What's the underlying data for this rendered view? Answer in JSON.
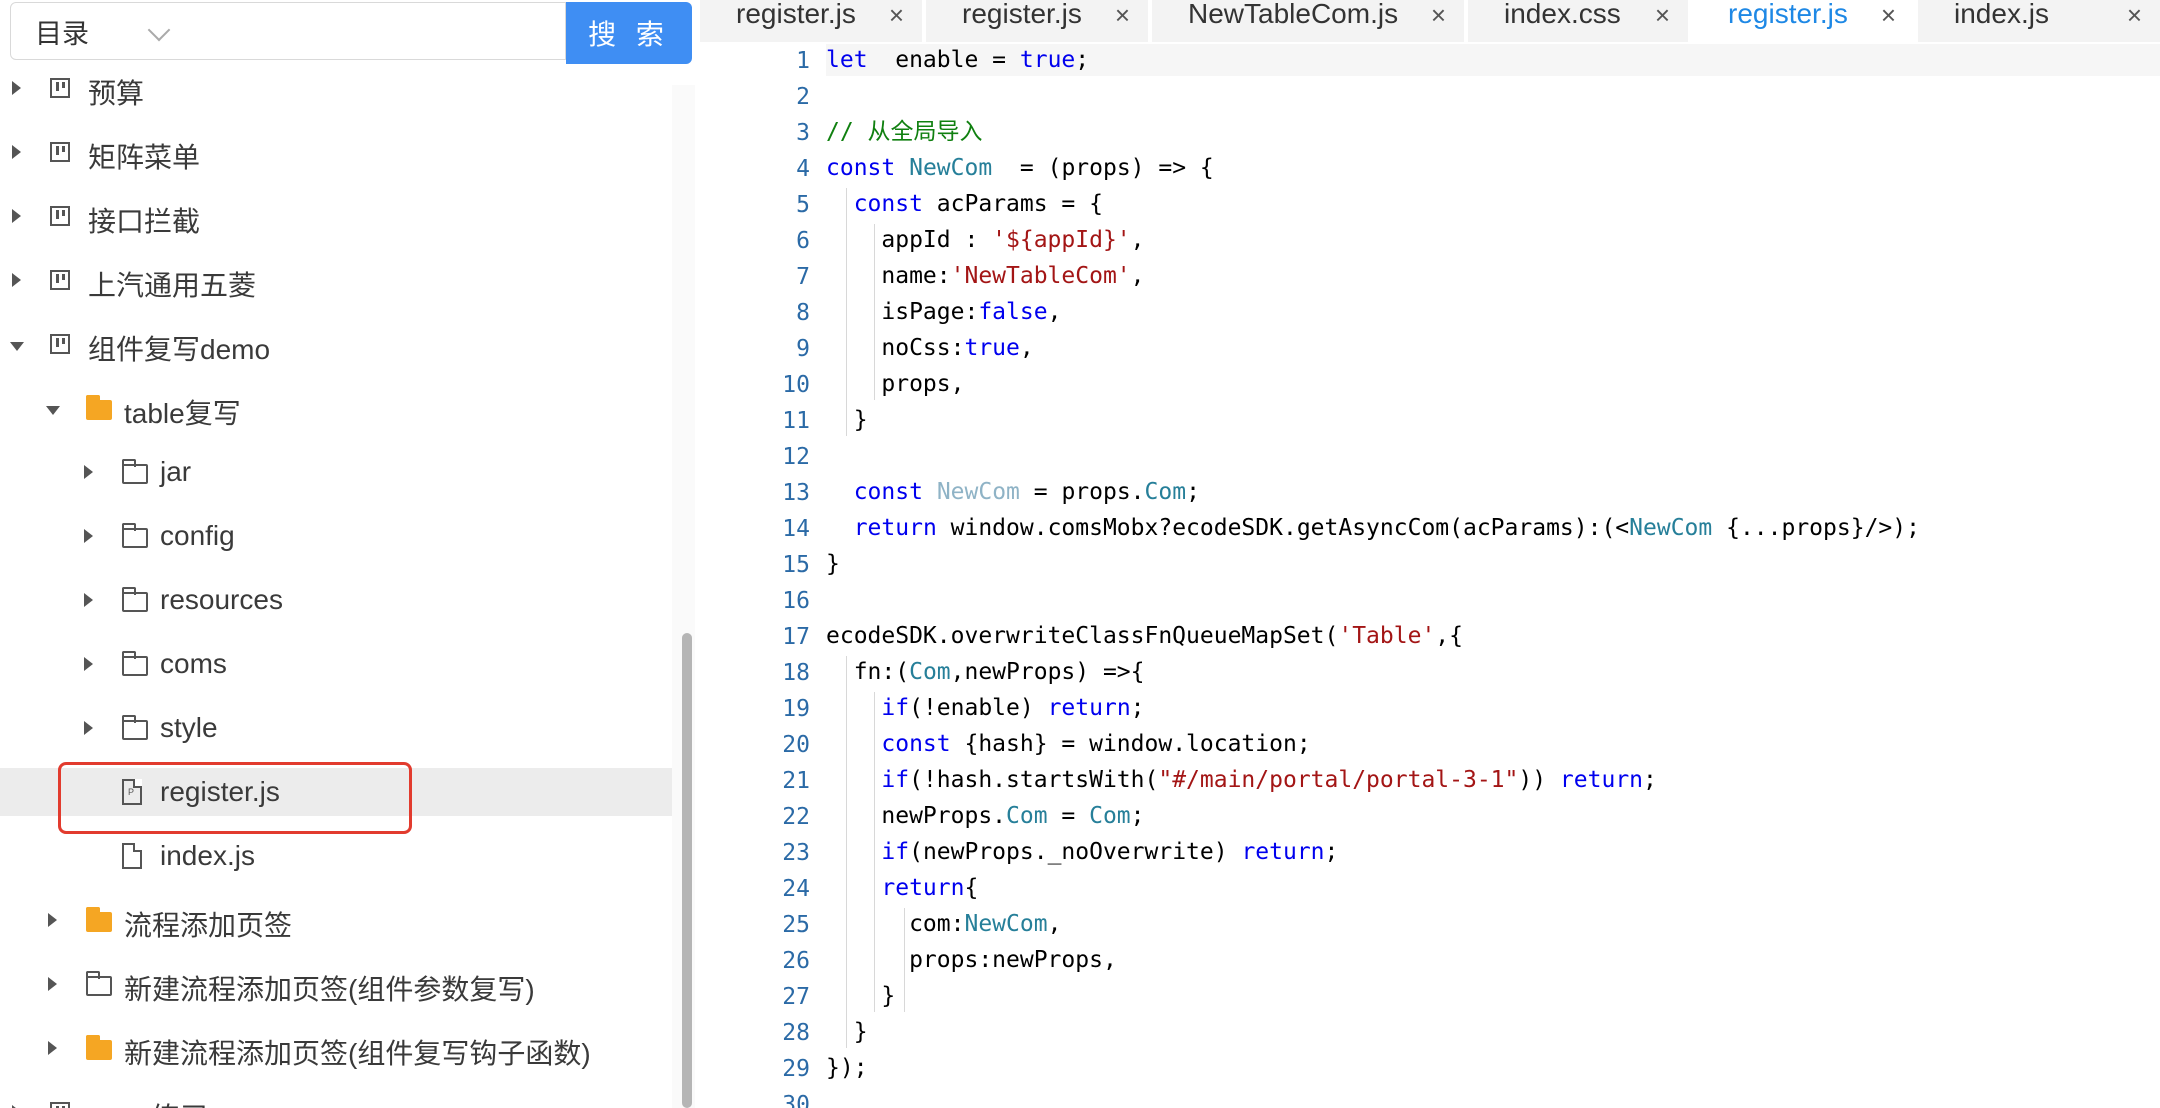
{
  "search": {
    "select_value": "目录",
    "input_value": "",
    "button_label": "搜 索"
  },
  "tree": [
    {
      "label": "预算",
      "icon": "board-icon",
      "level": 0,
      "expanded": false
    },
    {
      "label": "矩阵菜单",
      "icon": "board-icon",
      "level": 0,
      "expanded": false
    },
    {
      "label": "接口拦截",
      "icon": "board-icon",
      "level": 0,
      "expanded": false
    },
    {
      "label": "上汽通用五菱",
      "icon": "board-icon",
      "level": 0,
      "expanded": false
    },
    {
      "label": "组件复写demo",
      "icon": "board-icon",
      "level": 0,
      "expanded": true
    },
    {
      "label": "table复写",
      "icon": "folder-filled-icon",
      "level": 1,
      "expanded": true
    },
    {
      "label": "jar",
      "icon": "folder-icon",
      "level": 2,
      "expanded": false
    },
    {
      "label": "config",
      "icon": "folder-icon",
      "level": 2,
      "expanded": false
    },
    {
      "label": "resources",
      "icon": "folder-icon",
      "level": 2,
      "expanded": false
    },
    {
      "label": "coms",
      "icon": "folder-icon",
      "level": 2,
      "expanded": false
    },
    {
      "label": "style",
      "icon": "folder-icon",
      "level": 2,
      "expanded": false
    },
    {
      "label": "register.js",
      "icon": "file-p-icon",
      "level": 2,
      "leaf": true,
      "selected": true
    },
    {
      "label": "index.js",
      "icon": "file-icon",
      "level": 2,
      "leaf": true
    },
    {
      "label": "流程添加页签",
      "icon": "folder-filled-icon",
      "level": 1,
      "expanded": false
    },
    {
      "label": "新建流程添加页签(组件参数复写)",
      "icon": "folder-icon",
      "level": 1,
      "expanded": false
    },
    {
      "label": "新建流程添加页签(组件复写钩子函数)",
      "icon": "folder-filled-icon",
      "level": 1,
      "expanded": false
    },
    {
      "label": "…… 练习",
      "icon": "board-icon",
      "level": 0,
      "expanded": false
    }
  ],
  "tabs": [
    {
      "label": "register.js",
      "active": false
    },
    {
      "label": "register.js",
      "active": false
    },
    {
      "label": "NewTableCom.js",
      "active": false
    },
    {
      "label": "index.css",
      "active": false
    },
    {
      "label": "register.js",
      "active": true
    },
    {
      "label": "index.js",
      "active": false
    }
  ],
  "tab_close_glyph": "×",
  "colors": {
    "accent": "#3f8ef3",
    "active_tab": "#1e88e5",
    "highlight_border": "#e23b2e",
    "folder_filled": "#f5a623"
  },
  "code_lines": [
    [
      [
        "kw",
        "let"
      ],
      [
        "",
        "  enable = "
      ],
      [
        "kw",
        "true"
      ],
      [
        "",
        ";"
      ]
    ],
    [],
    [
      [
        "cm",
        "// 从全局导入"
      ]
    ],
    [
      [
        "kw",
        "const"
      ],
      [
        "",
        " "
      ],
      [
        "ty",
        "NewCom"
      ],
      [
        "",
        "  = (props) => {"
      ]
    ],
    [
      [
        "",
        ""
      ],
      [
        "kw",
        "const"
      ],
      [
        "",
        " acParams = {"
      ]
    ],
    [
      [
        "",
        "    appId : "
      ],
      [
        "st",
        "'${appId}'"
      ],
      [
        "",
        ","
      ]
    ],
    [
      [
        "",
        "    name:"
      ],
      [
        "st",
        "'NewTableCom'"
      ],
      [
        "",
        ","
      ]
    ],
    [
      [
        "",
        "    isPage:"
      ],
      [
        "kw",
        "false"
      ],
      [
        "",
        ","
      ]
    ],
    [
      [
        "",
        "    noCss:"
      ],
      [
        "kw",
        "true"
      ],
      [
        "",
        ","
      ]
    ],
    [
      [
        "",
        "    props,"
      ]
    ],
    [
      [
        "",
        "  }"
      ]
    ],
    [],
    [
      [
        "",
        "  "
      ],
      [
        "kw",
        "const"
      ],
      [
        "",
        " "
      ],
      [
        "pa",
        "NewCom"
      ],
      [
        "",
        " = props."
      ],
      [
        "ty",
        "Com"
      ],
      [
        "",
        ";"
      ]
    ],
    [
      [
        "",
        "  "
      ],
      [
        "kw",
        "return"
      ],
      [
        "",
        " window.comsMobx?ecodeSDK.getAsyncCom(acParams):(<"
      ],
      [
        "ty",
        "NewCom"
      ],
      [
        "",
        " {...props}/>);"
      ]
    ],
    [
      [
        "",
        "}"
      ]
    ],
    [],
    [
      [
        "",
        "ecodeSDK.overwriteClassFnQueueMapSet("
      ],
      [
        "st",
        "'Table'"
      ],
      [
        "",
        ",{"
      ]
    ],
    [
      [
        "",
        "  fn:("
      ],
      [
        "ty",
        "Com"
      ],
      [
        "",
        ",newProps) =>{"
      ]
    ],
    [
      [
        "",
        "    "
      ],
      [
        "kw",
        "if"
      ],
      [
        "",
        "(!enable) "
      ],
      [
        "kw",
        "return"
      ],
      [
        "",
        ";"
      ]
    ],
    [
      [
        "",
        "    "
      ],
      [
        "kw",
        "const"
      ],
      [
        "",
        " {hash} = window.location;"
      ]
    ],
    [
      [
        "",
        "    "
      ],
      [
        "kw",
        "if"
      ],
      [
        "",
        "(!hash.startsWith("
      ],
      [
        "st",
        "\"#/main/portal/portal-3-1\""
      ],
      [
        "",
        "))"
      ],
      [
        "kw",
        " return"
      ],
      [
        "",
        ";"
      ]
    ],
    [
      [
        "",
        "    newProps."
      ],
      [
        "ty",
        "Com"
      ],
      [
        "",
        " = "
      ],
      [
        "ty",
        "Com"
      ],
      [
        "",
        ";"
      ]
    ],
    [
      [
        "",
        "    "
      ],
      [
        "kw",
        "if"
      ],
      [
        "",
        "(newProps._noOverwrite) "
      ],
      [
        "kw",
        "return"
      ],
      [
        "",
        ";"
      ]
    ],
    [
      [
        "",
        "    "
      ],
      [
        "kw",
        "return"
      ],
      [
        "",
        "{"
      ]
    ],
    [
      [
        "",
        "      com:"
      ],
      [
        "ty",
        "NewCom"
      ],
      [
        "",
        ","
      ]
    ],
    [
      [
        "",
        "      props:newProps,"
      ]
    ],
    [
      [
        "",
        "    }"
      ]
    ],
    [
      [
        "",
        "  }"
      ]
    ],
    [
      [
        "",
        "});"
      ]
    ],
    []
  ]
}
